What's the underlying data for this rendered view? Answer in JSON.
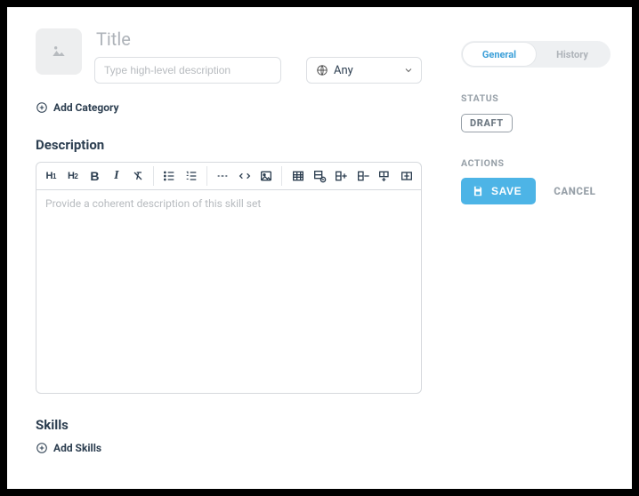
{
  "header": {
    "title_placeholder": "Title",
    "desc_placeholder": "Type high-level description",
    "visibility_select": {
      "value": "Any"
    }
  },
  "add_category_label": "Add Category",
  "sections": {
    "description": {
      "heading": "Description",
      "placeholder": "Provide a coherent description of this skill set"
    },
    "skills": {
      "heading": "Skills",
      "add_label": "Add Skills"
    }
  },
  "toolbar": {
    "h1": "H1",
    "h2": "H2"
  },
  "sidebar": {
    "tabs": {
      "general": "General",
      "history": "History"
    },
    "status_label": "STATUS",
    "status_value": "DRAFT",
    "actions_label": "ACTIONS",
    "save": "SAVE",
    "cancel": "CANCEL"
  }
}
